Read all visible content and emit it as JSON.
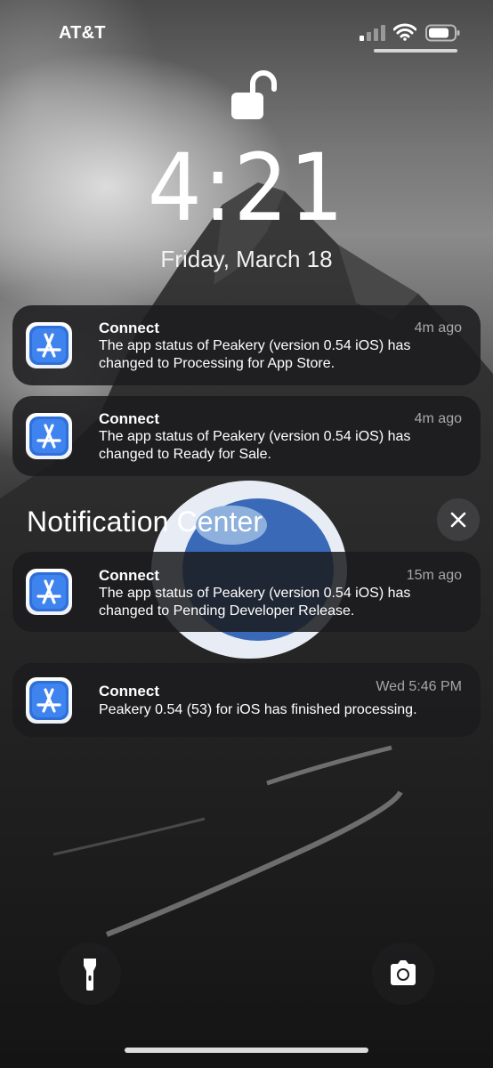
{
  "status_bar": {
    "carrier": "AT&T",
    "signal_icon": "cellular-signal-icon",
    "wifi_icon": "wifi-icon",
    "battery_icon": "battery-icon"
  },
  "lock": {
    "icon": "unlocked-padlock-icon"
  },
  "clock": {
    "time": "4:21",
    "date": "Friday, March 18"
  },
  "notifications_recent": [
    {
      "app": "Connect",
      "time": "4m ago",
      "body": "The app status of Peakery (version 0.54 iOS) has\nchanged to Processing for App Store."
    },
    {
      "app": "Connect",
      "time": "4m ago",
      "body": "The app status of Peakery (version 0.54 iOS) has\nchanged to Ready for Sale."
    }
  ],
  "notification_center": {
    "header": "Notification Center",
    "close_icon": "close-x-icon",
    "items": [
      {
        "app": "Connect",
        "time": "15m ago",
        "body": "The app status of Peakery (version 0.54 iOS) has\nchanged to Pending Developer Release."
      },
      {
        "app": "Connect",
        "time": "Wed 5:46 PM",
        "body": "Peakery 0.54 (53) for iOS has finished processing."
      }
    ]
  },
  "quick_actions": {
    "flashlight_icon": "flashlight-icon",
    "camera_icon": "camera-icon"
  },
  "colors": {
    "notification_bg": "#1c1c1e",
    "app_icon_blue": "#2f6fd8"
  }
}
